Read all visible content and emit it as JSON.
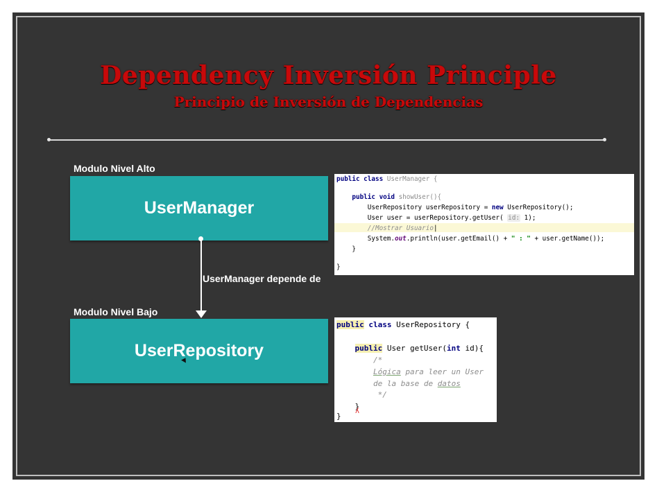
{
  "title": "Dependency Inversión Principle",
  "subtitle": "Principio de Inversión de Dependencias",
  "high_module": {
    "label": "Modulo Nivel Alto",
    "box": "UserManager"
  },
  "low_module": {
    "label": "Modulo Nivel Bajo",
    "box": "UserRepository"
  },
  "arrow_label": "UserManager depende de",
  "code_user_manager": {
    "line1_kw": "public class",
    "line1_rest": " UserManager {",
    "line3_kw": "    public void",
    "line3_rest": " showUser(){",
    "line4_a": "        UserRepository userRepository = ",
    "line4_kw": "new",
    "line4_b": " UserRepository();",
    "line5_a": "        User user = userRepository.getUser( ",
    "line5_hint": "id:",
    "line5_b": " 1);",
    "line6_comment": "        //Mostrar Usuario",
    "line7_a": "        System.",
    "line7_field": "out",
    "line7_b": ".println(user.getEmail() + ",
    "line7_str": "\" : \"",
    "line7_c": " + user.getName());",
    "line8": "    }",
    "line10": "}"
  },
  "code_user_repository": {
    "line1_kw1": "public",
    "line1_kw2": " class",
    "line1_rest": " UserRepository {",
    "line3_kw": "public",
    "line3_a": " User getUser(",
    "line3_kw2": "int",
    "line3_b": " id){",
    "line4": "        /*",
    "line5_a": "Lógica",
    "line5_b": " para leer un User",
    "line6_a": "de la base de ",
    "line6_b": "datos",
    "line7": "         */",
    "line8": "    }",
    "line9": "}"
  },
  "colors": {
    "background": "#343434",
    "title": "#c8090a",
    "box": "#21a7a6"
  }
}
